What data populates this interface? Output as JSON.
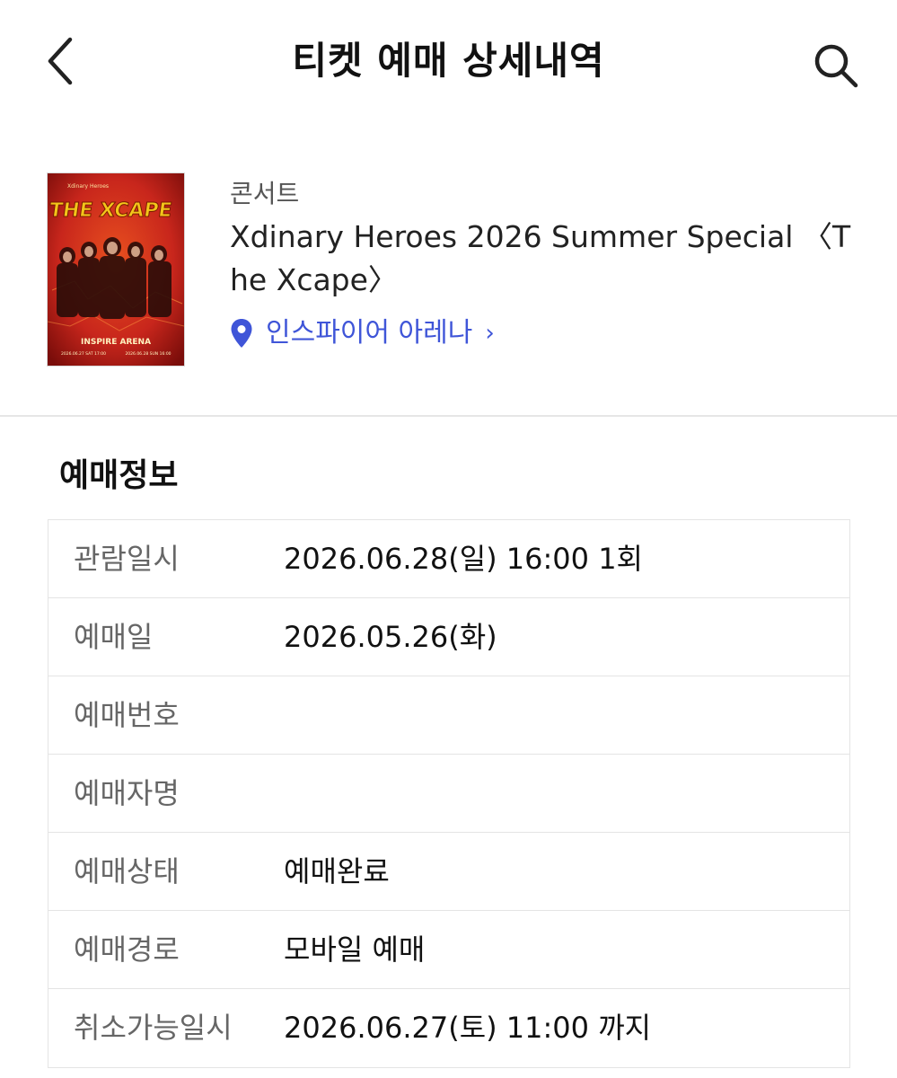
{
  "header": {
    "title": "티켓 예매 상세내역",
    "back_icon": "chevron-left-icon",
    "search_icon": "search-icon"
  },
  "event": {
    "category": "콘서트",
    "title": "Xdinary Heroes 2026 Summer Special 〈The Xcape〉",
    "venue": "인스파이어 아레나",
    "venue_chevron": "›",
    "poster": {
      "band": "Xdinary Heroes",
      "logo_text": "THE XCAPE",
      "arena_text": "INSPIRE ARENA",
      "date1": "2026.06.27 SAT 17:00",
      "date2": "2026.06.28 SUN 16:00",
      "colors": {
        "bg": "#c8261c",
        "accent": "#f3c51a"
      }
    }
  },
  "booking": {
    "section_title": "예매정보",
    "rows": [
      {
        "label": "관람일시",
        "value": "2026.06.28(일) 16:00 1회"
      },
      {
        "label": "예매일",
        "value": "2026.05.26(화)"
      },
      {
        "label": "예매번호",
        "value": ""
      },
      {
        "label": "예매자명",
        "value": ""
      },
      {
        "label": "예매상태",
        "value": "예매완료"
      },
      {
        "label": "예매경로",
        "value": "모바일 예매"
      },
      {
        "label": "취소가능일시",
        "value": "2026.06.27(토) 11:00 까지"
      }
    ]
  },
  "colors": {
    "link": "#3f55d8",
    "divider": "#e6e6e6",
    "label": "#666666"
  }
}
